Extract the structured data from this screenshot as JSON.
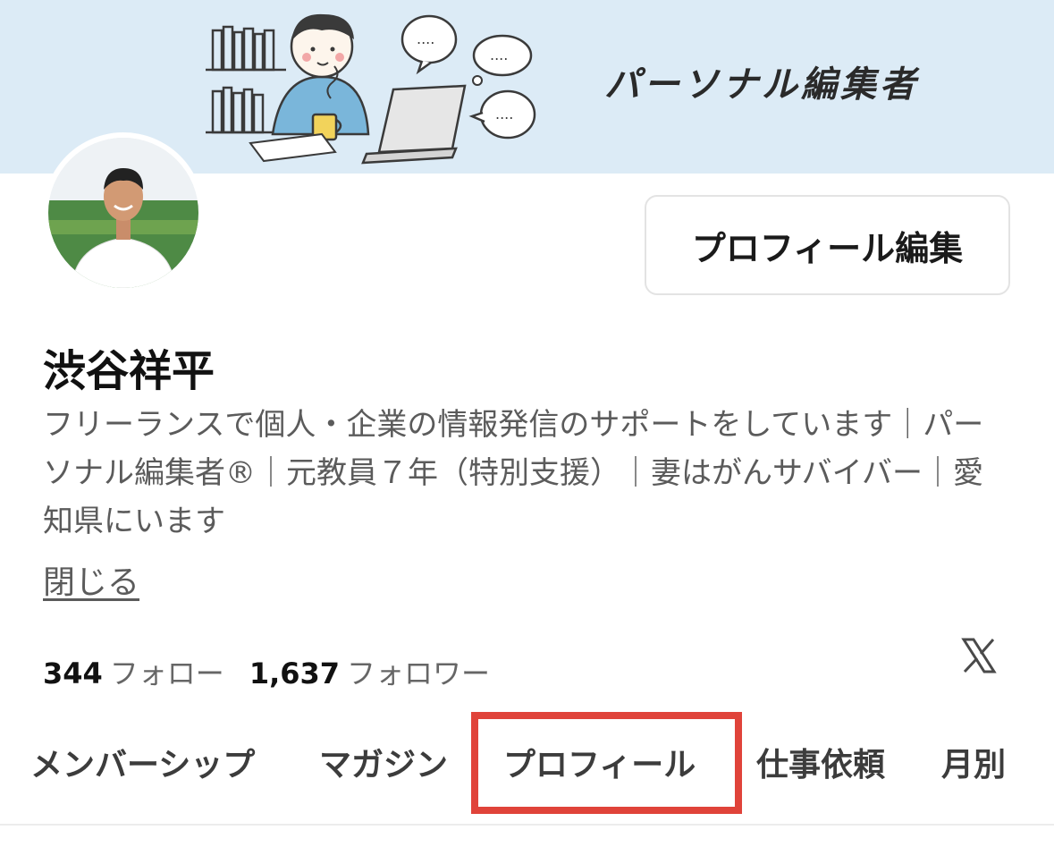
{
  "banner": {
    "title": "パーソナル編集者",
    "colors": {
      "background": "#dcebf6"
    }
  },
  "profile": {
    "name": "渋谷祥平",
    "bio": "フリーランスで個人・企業の情報発信のサポートをしています｜パーソナル編集者®｜元教員７年（特別支援）｜妻はがんサバイバー｜愛知県にいます",
    "close_label": "閉じる",
    "edit_button_label": "プロフィール編集"
  },
  "stats": {
    "following_count": "344",
    "following_label": "フォロー",
    "followers_count": "1,637",
    "followers_label": "フォロワー"
  },
  "social": {
    "icon": "x-logo-icon"
  },
  "tabs": [
    {
      "label": "メンバーシップ"
    },
    {
      "label": "マガジン"
    },
    {
      "label": "プロフィール",
      "highlighted": true
    },
    {
      "label": "仕事依頼"
    },
    {
      "label": "月別"
    }
  ],
  "colors": {
    "highlight_border": "#e0433a",
    "text_primary": "#111111",
    "text_secondary": "#5b5b5b"
  }
}
